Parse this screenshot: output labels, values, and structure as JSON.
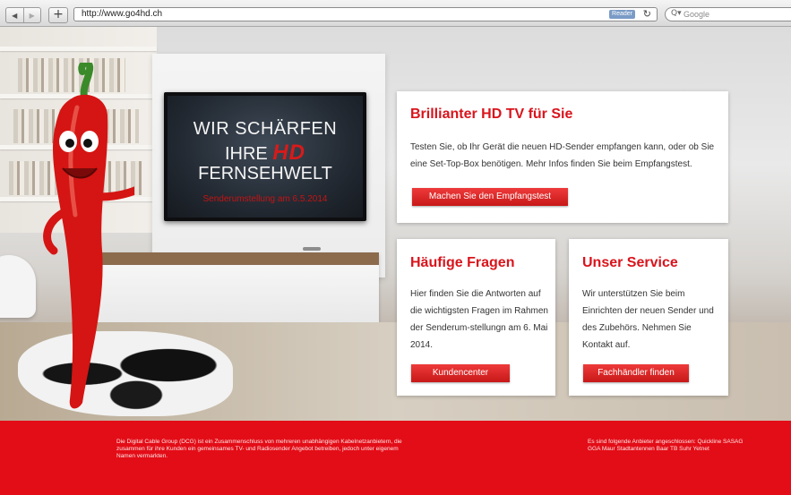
{
  "browser": {
    "url": "http://www.go4hd.ch",
    "reader_label": "Reader",
    "search_placeholder": "Google",
    "back_icon": "◀",
    "forward_icon": "▶",
    "add_icon": "+",
    "reload_icon": "↻",
    "search_icon": "Q▾"
  },
  "hero": {
    "tv_line1": "WIR SCHÄRFEN",
    "tv_line2_prefix": "IHRE",
    "tv_hd": "HD",
    "tv_line3": "FERNSEHWELT",
    "tv_line4": "Senderumstellung am 6.5.2014"
  },
  "cards": {
    "tv": {
      "title": "Brillianter HD TV für Sie",
      "text": "Testen Sie, ob Ihr Gerät die neuen HD-Sender empfangen kann, oder ob Sie eine Set-Top-Box benötigen. Mehr Infos finden Sie beim Empfangstest.",
      "button": "Machen Sie den Empfangstest"
    },
    "faq": {
      "title": "Häufige Fragen",
      "text": "Hier finden Sie die Antworten auf die wichtigsten Fragen im Rahmen der Senderum-stellungn am 6. Mai 2014.",
      "button": "Kundencenter"
    },
    "service": {
      "title": "Unser Service",
      "text": "Wir unterstützen Sie beim Einrichten der neuen Sender und des Zubehörs. Nehmen Sie Kontakt auf.",
      "button": "Fachhändler finden"
    }
  },
  "footer": {
    "left_text": "Die Digital Cable Group (DCG) ist ein Zusammenschluss von mehreren unabhängigen Kabelnetzanbietern, die zusammen für ihre Kunden ein gemeinsames TV- und Radiosender Angebot betreiben, jedoch unter eigenem Namen vermarkten.",
    "right_text": "Es sind folgende Anbieter angeschlossen: Quickline SASAG GGA Maur Stadtantennen Baar TB Suhr Yetnet"
  },
  "colors": {
    "brand_red": "#d9141c",
    "footer_red": "#e30d17",
    "button_red": "#d82020"
  }
}
